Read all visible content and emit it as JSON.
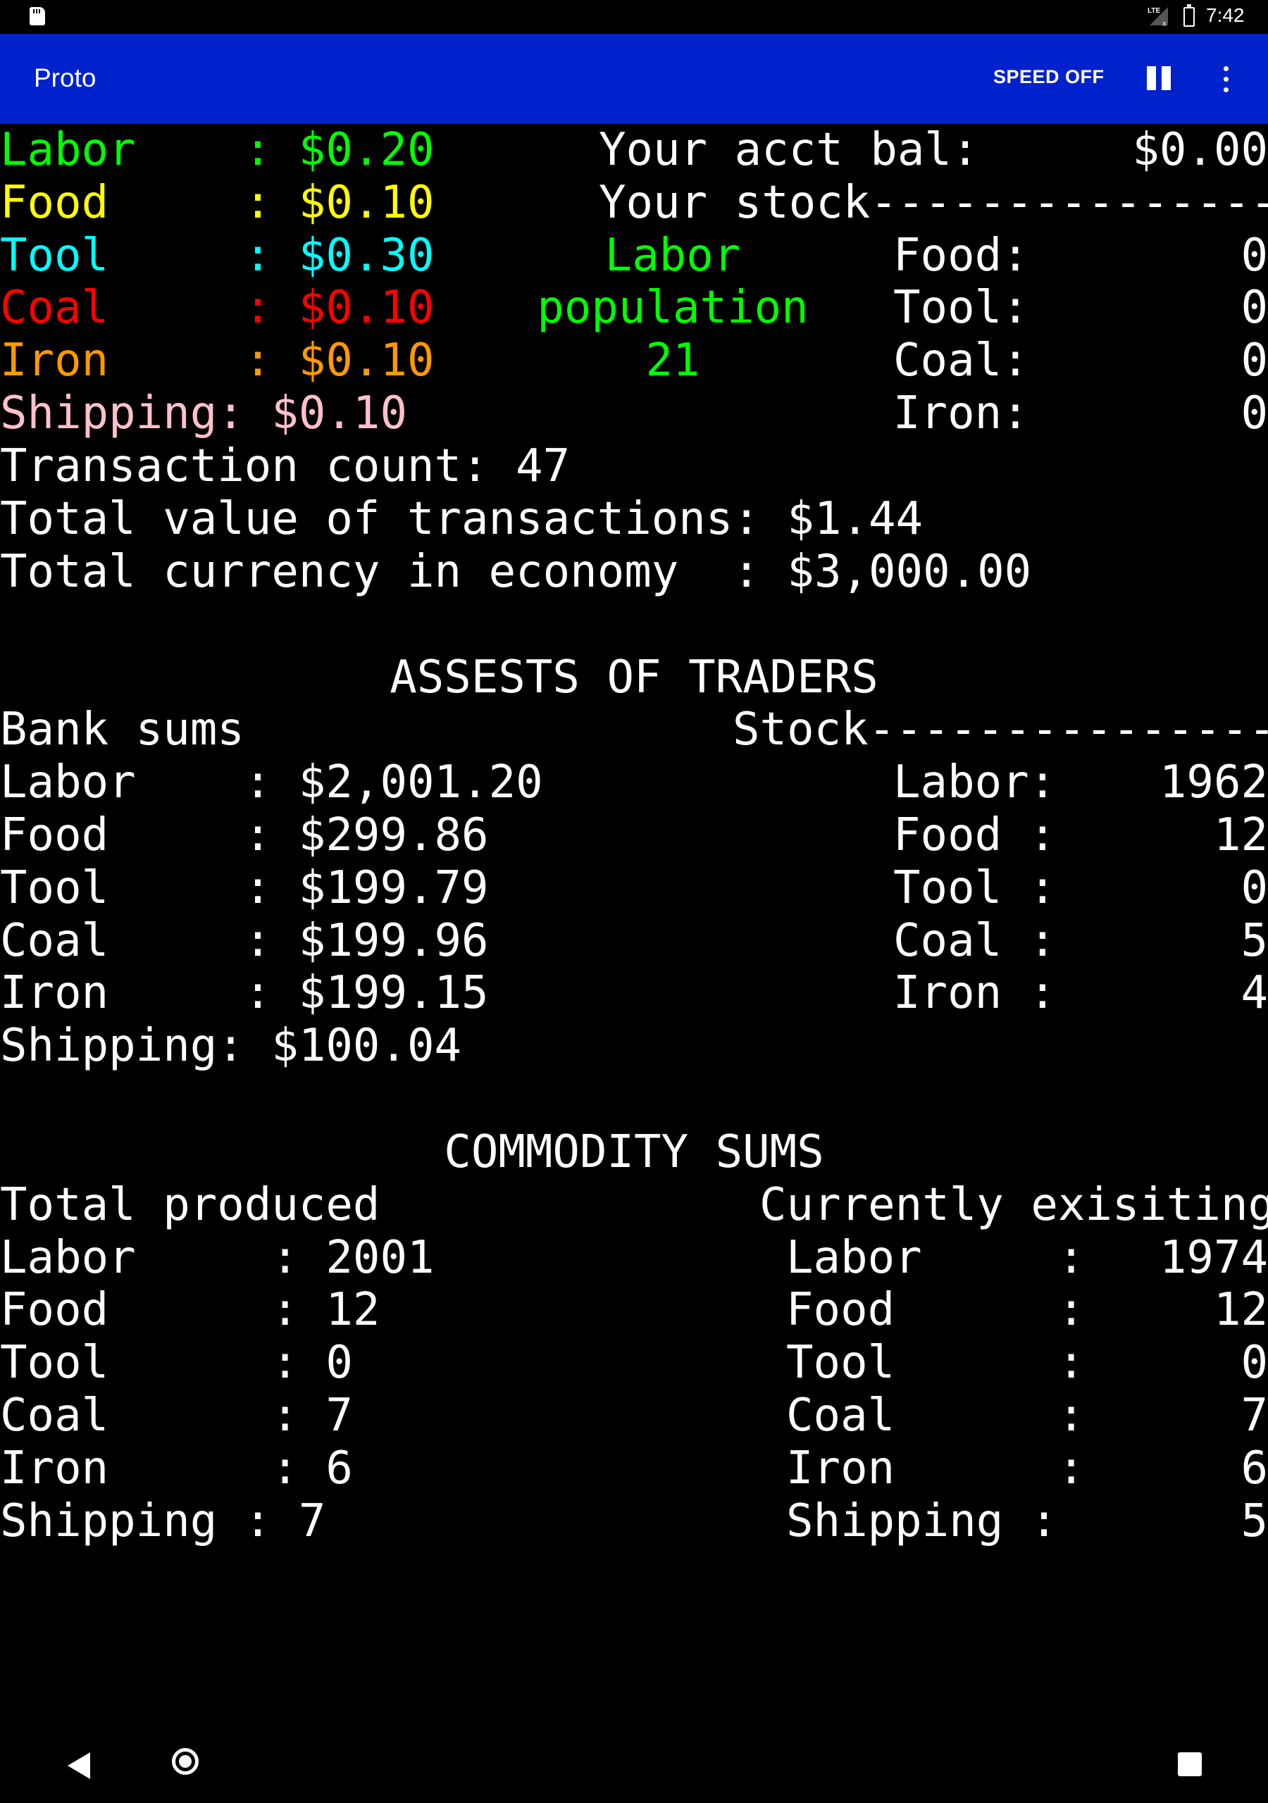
{
  "status_bar": {
    "time": "7:42",
    "icons": [
      "sd-card-icon",
      "lte-signal-icon",
      "battery-icon"
    ]
  },
  "app_bar": {
    "title": "Proto",
    "speed_button": "SPEED OFF",
    "icons": [
      "pause-icon",
      "more-vert-icon"
    ]
  },
  "prices": [
    {
      "label": "Labor    ",
      "value": "$0.20",
      "color": "#00ff00"
    },
    {
      "label": "Food     ",
      "value": "$0.10",
      "color": "#ffff00"
    },
    {
      "label": "Tool     ",
      "value": "$0.30",
      "color": "#00ffff"
    },
    {
      "label": "Coal     ",
      "value": "$0.10",
      "color": "#ff0000"
    },
    {
      "label": "Iron     ",
      "value": "$0.10",
      "color": "#ff9900"
    },
    {
      "label": "Shipping",
      "value": "$0.10",
      "color": "#ffc0cb"
    }
  ],
  "account": {
    "balance_label": "Your acct bal:",
    "balance_value": "$0.00",
    "stock_label": "Your stock---------------",
    "stock": [
      {
        "label": "Food:",
        "value": "0"
      },
      {
        "label": "Tool:",
        "value": "0"
      },
      {
        "label": "Coal:",
        "value": "0"
      },
      {
        "label": "Iron:",
        "value": "0"
      }
    ]
  },
  "labor_population": {
    "line1": "Labor",
    "line2": "population",
    "value": "21"
  },
  "summary": {
    "transaction_count": "Transaction count: 47",
    "total_value": "Total value of transactions: $1.44",
    "total_currency": "Total currency in economy  : $3,000.00"
  },
  "assets": {
    "heading": "ASSESTS OF TRADERS",
    "bank_header": "Bank sums",
    "stock_header": "Stock---------------",
    "bank": [
      {
        "label": "Labor    : ",
        "value": "$2,001.20"
      },
      {
        "label": "Food     : ",
        "value": "$299.86"
      },
      {
        "label": "Tool     : ",
        "value": "$199.79"
      },
      {
        "label": "Coal     : ",
        "value": "$199.96"
      },
      {
        "label": "Iron     : ",
        "value": "$199.15"
      },
      {
        "label": "Shipping: ",
        "value": "$100.04"
      }
    ],
    "stock": [
      {
        "label": "Labor:",
        "value": "1962"
      },
      {
        "label": "Food :",
        "value": "12"
      },
      {
        "label": "Tool :",
        "value": "0"
      },
      {
        "label": "Coal :",
        "value": "5"
      },
      {
        "label": "Iron :",
        "value": "4"
      }
    ]
  },
  "commodities": {
    "heading": "COMMODITY SUMS",
    "produced_header": "Total produced",
    "existing_header": "Currently exisiting",
    "produced": [
      {
        "label": "Labor     : ",
        "value": "2001"
      },
      {
        "label": "Food      : ",
        "value": "12"
      },
      {
        "label": "Tool      : ",
        "value": "0"
      },
      {
        "label": "Coal      : ",
        "value": "7"
      },
      {
        "label": "Iron      : ",
        "value": "6"
      },
      {
        "label": "Shipping : ",
        "value": "7"
      }
    ],
    "existing": [
      {
        "label": "Labor     :",
        "value": "1974"
      },
      {
        "label": "Food      :",
        "value": "12"
      },
      {
        "label": "Tool      :",
        "value": "0"
      },
      {
        "label": "Coal      :",
        "value": "7"
      },
      {
        "label": "Iron      :",
        "value": "6"
      },
      {
        "label": "Shipping :",
        "value": "5"
      }
    ]
  },
  "nav_bar": {
    "icons": [
      "back-icon",
      "home-icon",
      "recents-icon"
    ]
  }
}
